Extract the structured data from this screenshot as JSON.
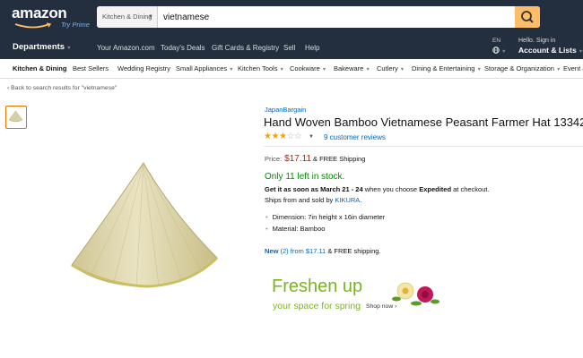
{
  "header": {
    "logo_text": "amazon",
    "logo_sub": "Try Prime",
    "search_category": "Kitchen & Dining",
    "search_value": "vietnamese",
    "search_icon": "search-icon"
  },
  "nav": {
    "departments": "Departments",
    "links": [
      "Your Amazon.com",
      "Today's Deals",
      "Gift Cards & Registry",
      "Sell",
      "Help"
    ],
    "lang_code": "EN",
    "lang_icon": "globe-icon",
    "hello": "Hello. Sign in",
    "account": "Account & Lists"
  },
  "subnav": {
    "items": [
      "Kitchen & Dining",
      "Best Sellers",
      "Wedding Registry",
      "Small Appliances",
      "Kitchen Tools",
      "Cookware",
      "Bakeware",
      "Cutlery",
      "Dining & Entertaining",
      "Storage & Organization",
      "Event &"
    ]
  },
  "back_link": "‹ Back to search results for \"vietnamese\"",
  "product": {
    "brand": "JapanBargain",
    "title": "Hand Woven Bamboo Vietnamese Peasant Farmer Hat 13342",
    "rating_stars": 3,
    "rating_max": 5,
    "reviews": "9 customer reviews",
    "price_label": "Price:",
    "price": "$17.11",
    "shipping": "& FREE Shipping",
    "stock": "Only 11 left in stock.",
    "delivery_pre": "Get it as soon as March 21 - 24",
    "delivery_mid": " when you choose ",
    "delivery_bold": "Expedited",
    "delivery_post": " at checkout.",
    "ships_pre": "Ships from and sold by ",
    "seller": "KIKURA",
    "ships_post": ".",
    "bullets": [
      "Dimension: 7in height x 16in diameter",
      "Material: Bamboo"
    ],
    "offers_new": "New",
    "offers_link": "(2) from $17.11",
    "offers_post": " & FREE shipping."
  },
  "ad": {
    "headline": "Freshen up",
    "subline": "your space for spring",
    "shop": "Shop now ›"
  },
  "colors": {
    "header_bg": "#232f3e",
    "search_button": "#febd69",
    "link": "#0066c0",
    "price": "#b12704",
    "in_stock": "#008a00",
    "star": "#f0a500",
    "ad_green": "#7ab51d"
  }
}
